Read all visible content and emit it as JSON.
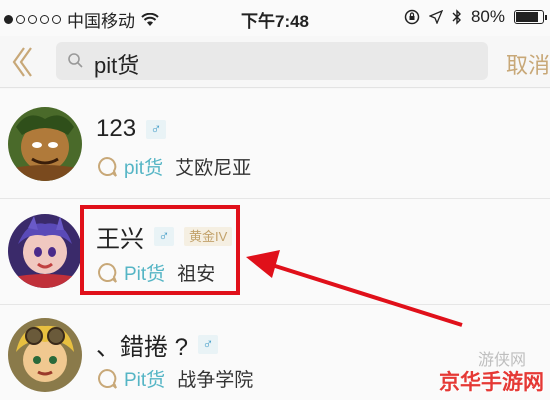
{
  "status_bar": {
    "carrier": "中国移动",
    "time": "下午7:48",
    "battery": "80%",
    "battery_level": 0.8
  },
  "header": {
    "search_query": "pit货",
    "cancel_label": "取消"
  },
  "results": [
    {
      "name": "123",
      "gender": "♂",
      "rank": "",
      "game": "pit货",
      "server": "艾欧尼亚"
    },
    {
      "name": "王兴",
      "gender": "♂",
      "rank": "黄金IV",
      "game": "Pit货",
      "server": "祖安"
    },
    {
      "name": "、錯捲 ?",
      "gender": "♂",
      "rank": "",
      "game": "Pit货",
      "server": "战争学院"
    }
  ],
  "watermark": {
    "text": "京华手游网",
    "faint": "游侠网"
  },
  "colors": {
    "accent_gold": "#c8a878",
    "game_teal": "#55b5c5",
    "highlight_red": "#e0101a"
  }
}
